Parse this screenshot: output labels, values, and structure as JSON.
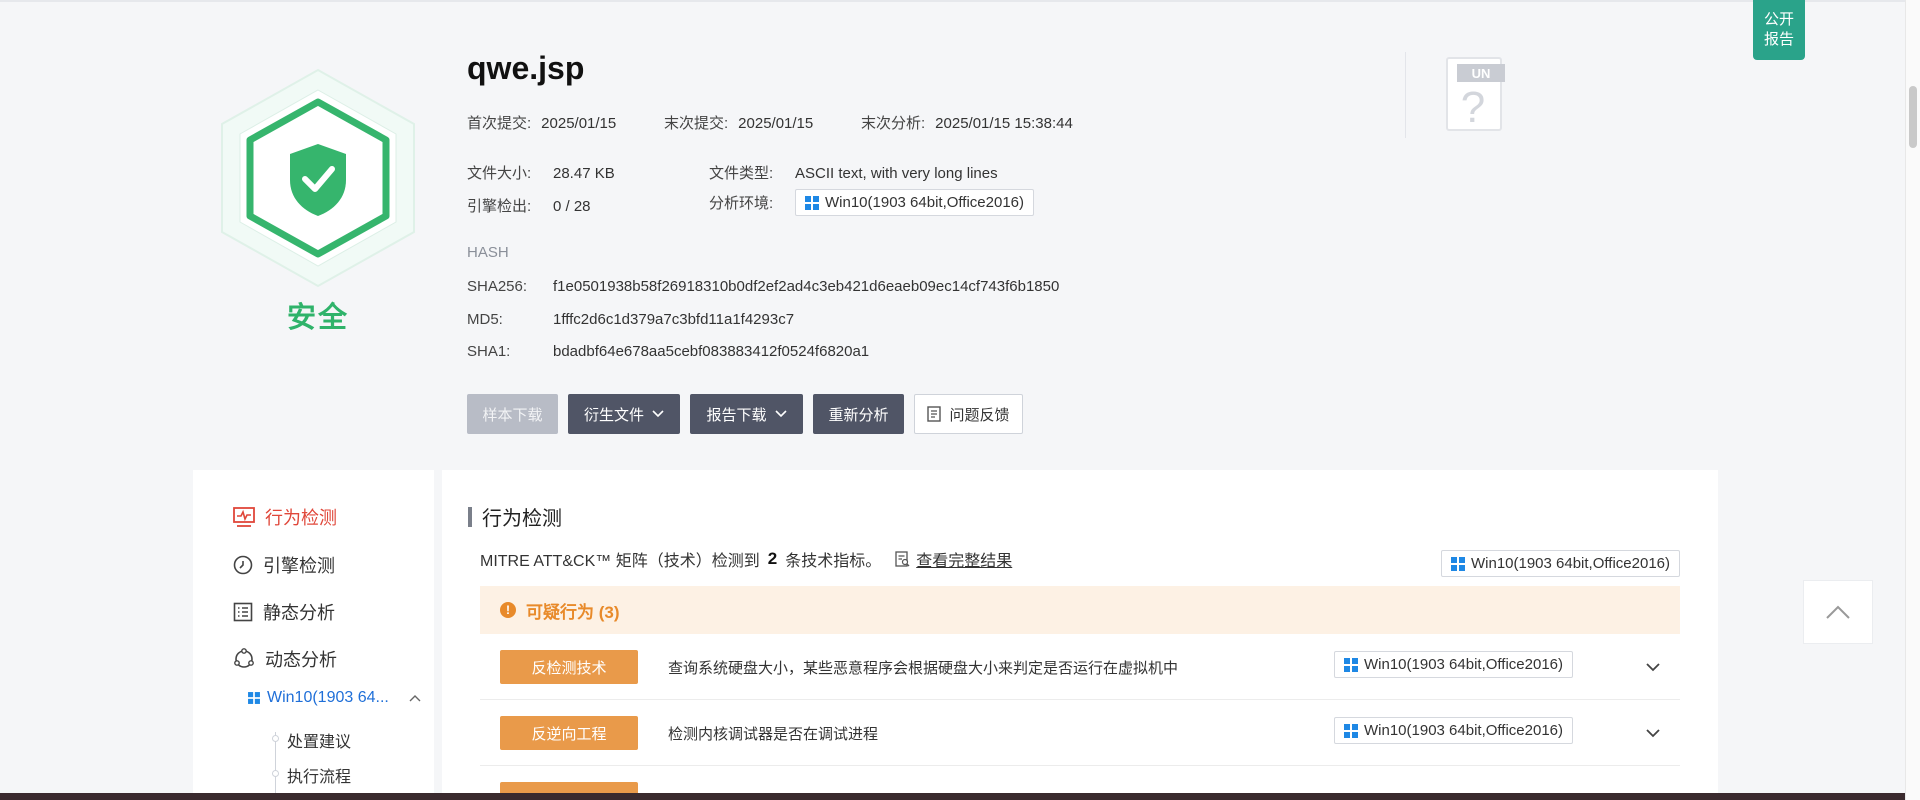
{
  "public_report": {
    "line1": "公开",
    "line2": "报告"
  },
  "verdict": {
    "label": "安全",
    "color": "#2fb36a"
  },
  "file": {
    "name": "qwe.jsp",
    "first_submit_key": "首次提交:",
    "first_submit": "2025/01/15",
    "last_submit_key": "末次提交:",
    "last_submit": "2025/01/15",
    "last_analysis_key": "末次分析:",
    "last_analysis": "2025/01/15 15:38:44",
    "size_key": "文件大小:",
    "size": "28.47 KB",
    "type_key": "文件类型:",
    "type": "ASCII text, with very long lines",
    "engine_key": "引擎检出:",
    "engine": "0 / 28",
    "env_key": "分析环境:",
    "env": "Win10(1903 64bit,Office2016)"
  },
  "hash": {
    "title": "HASH",
    "sha256_key": "SHA256:",
    "sha256": "f1e0501938b58f26918310b0df2ef2ad4c3eb421d6eaeb09ec14cf743f6b1850",
    "md5_key": "MD5:",
    "md5": "1fffc2d6c1d379a7c3bfd11a1f4293c7",
    "sha1_key": "SHA1:",
    "sha1": "bdadbf64e678aa5cebf083883412f0524f6820a1"
  },
  "buttons": {
    "sample_download": "样本下载",
    "derived_files": "衍生文件",
    "report_download": "报告下载",
    "reanalyze": "重新分析",
    "feedback": "问题反馈"
  },
  "unknown_badge": {
    "label": "UN",
    "mark": "?"
  },
  "sidebar": {
    "behavior": "行为检测",
    "engine": "引擎检测",
    "static": "静态分析",
    "dynamic": "动态分析",
    "env_item": "Win10(1903 64...",
    "disposal": "处置建议",
    "flow": "执行流程"
  },
  "content": {
    "title": "行为检测",
    "mitre_prefix": "MITRE ATT&CK™ 矩阵（技术）检测到",
    "mitre_count": "2",
    "mitre_suffix": "条技术指标。",
    "full_result_link": "查看完整结果",
    "env": "Win10(1903 64bit,Office2016)",
    "suspicious_header": "可疑行为 (3)",
    "rows": [
      {
        "tag": "反检测技术",
        "desc": "查询系统硬盘大小，某些恶意程序会根据硬盘大小来判定是否运行在虚拟机中",
        "env": "Win10(1903 64bit,Office2016)"
      },
      {
        "tag": "反逆向工程",
        "desc": "检测内核调试器是否在调试进程",
        "env": "Win10(1903 64bit,Office2016)"
      }
    ]
  }
}
